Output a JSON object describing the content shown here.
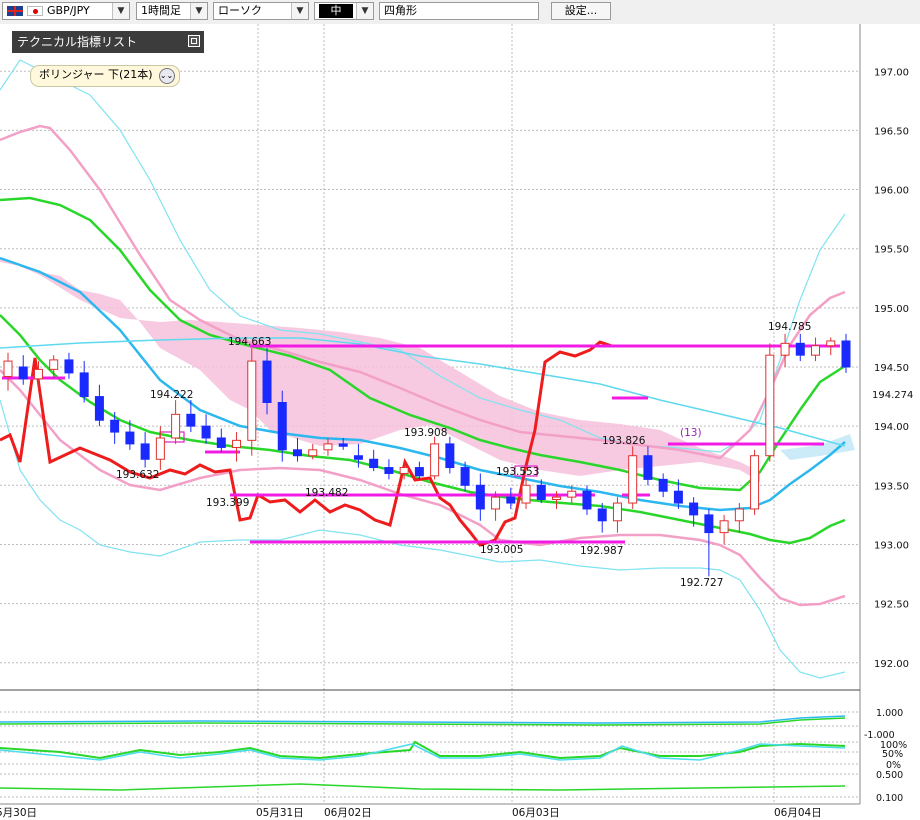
{
  "toolbar": {
    "pair": "GBP/JPY",
    "timeframe": "1時間足",
    "chart_style": "ローソク",
    "line_width": "中",
    "drawing_tool": "四角形",
    "settings_label": "設定..."
  },
  "indicator_panel": {
    "title": "テクニカル指標リスト",
    "bubble_label": "ボリンジャー 下(21本)"
  },
  "annotations": {
    "high_194663": "194.663",
    "high_194222": "194.222",
    "low_193632": "193.632",
    "low_193399": "193.399",
    "low_193482": "193.482",
    "high_193908": "193.908",
    "box_193553": "193.553",
    "low_193005": "193.005",
    "high_193826": "193.826",
    "low_192987": "192.987",
    "low_192727": "192.727",
    "high_194785": "194.785",
    "count_13": "(13)"
  },
  "chart_data": {
    "type": "line",
    "instrument": "GBP/JPY",
    "ylim": [
      191.5,
      197.2
    ],
    "y_ticks": [
      "197.00",
      "196.50",
      "196.00",
      "195.50",
      "195.00",
      "194.50",
      "194.00",
      "193.50",
      "193.00",
      "192.50",
      "192.00"
    ],
    "current_price": "194.274",
    "x_tick_labels": [
      "5月30日",
      "05月31日",
      "06月02日",
      "06月03日",
      "06月04日"
    ],
    "candles_ohlc": [
      [
        194.42,
        194.62,
        194.3,
        194.55
      ],
      [
        194.5,
        194.6,
        194.35,
        194.4
      ],
      [
        194.4,
        194.55,
        194.3,
        194.48
      ],
      [
        194.48,
        194.6,
        194.4,
        194.56
      ],
      [
        194.56,
        194.62,
        194.4,
        194.45
      ],
      [
        194.45,
        194.55,
        194.2,
        194.25
      ],
      [
        194.25,
        194.35,
        194.0,
        194.05
      ],
      [
        194.05,
        194.12,
        193.85,
        193.95
      ],
      [
        193.95,
        194.05,
        193.8,
        193.85
      ],
      [
        193.85,
        193.95,
        193.65,
        193.72
      ],
      [
        193.72,
        194.0,
        193.63,
        193.9
      ],
      [
        193.9,
        194.22,
        193.85,
        194.1
      ],
      [
        194.1,
        194.22,
        193.95,
        194.0
      ],
      [
        194.0,
        194.1,
        193.85,
        193.9
      ],
      [
        193.9,
        193.98,
        193.78,
        193.82
      ],
      [
        193.82,
        193.95,
        193.7,
        193.88
      ],
      [
        193.88,
        194.66,
        193.75,
        194.55
      ],
      [
        194.55,
        194.66,
        194.1,
        194.2
      ],
      [
        194.2,
        194.3,
        193.7,
        193.8
      ],
      [
        193.8,
        193.9,
        193.7,
        193.75
      ],
      [
        193.75,
        193.85,
        193.72,
        193.8
      ],
      [
        193.8,
        193.9,
        193.75,
        193.85
      ],
      [
        193.85,
        193.9,
        193.8,
        193.83
      ],
      [
        193.75,
        193.85,
        193.65,
        193.72
      ],
      [
        193.72,
        193.8,
        193.62,
        193.65
      ],
      [
        193.65,
        193.72,
        193.55,
        193.6
      ],
      [
        193.6,
        193.7,
        193.55,
        193.65
      ],
      [
        193.65,
        193.7,
        193.55,
        193.58
      ],
      [
        193.58,
        193.91,
        193.55,
        193.85
      ],
      [
        193.85,
        193.91,
        193.6,
        193.65
      ],
      [
        193.65,
        193.7,
        193.45,
        193.5
      ],
      [
        193.5,
        193.6,
        193.2,
        193.3
      ],
      [
        193.3,
        193.45,
        193.2,
        193.4
      ],
      [
        193.4,
        193.48,
        193.3,
        193.35
      ],
      [
        193.35,
        193.55,
        193.3,
        193.5
      ],
      [
        193.5,
        193.55,
        193.35,
        193.38
      ],
      [
        193.38,
        193.45,
        193.3,
        193.4
      ],
      [
        193.4,
        193.5,
        193.35,
        193.45
      ],
      [
        193.45,
        193.5,
        193.25,
        193.3
      ],
      [
        193.3,
        193.35,
        193.1,
        193.2
      ],
      [
        193.2,
        193.4,
        193.1,
        193.35
      ],
      [
        193.35,
        193.83,
        193.3,
        193.75
      ],
      [
        193.75,
        193.83,
        193.5,
        193.55
      ],
      [
        193.55,
        193.6,
        193.4,
        193.45
      ],
      [
        193.45,
        193.55,
        193.3,
        193.35
      ],
      [
        193.35,
        193.4,
        193.15,
        193.25
      ],
      [
        193.25,
        193.3,
        192.73,
        193.1
      ],
      [
        193.1,
        193.25,
        193.0,
        193.2
      ],
      [
        193.2,
        193.35,
        193.1,
        193.3
      ],
      [
        193.3,
        193.8,
        193.25,
        193.75
      ],
      [
        193.75,
        194.7,
        193.7,
        194.6
      ],
      [
        194.6,
        194.78,
        194.5,
        194.7
      ],
      [
        194.7,
        194.78,
        194.55,
        194.6
      ],
      [
        194.6,
        194.75,
        194.55,
        194.68
      ],
      [
        194.68,
        194.75,
        194.6,
        194.72
      ],
      [
        194.72,
        194.78,
        194.45,
        194.5
      ]
    ],
    "series": []
  }
}
